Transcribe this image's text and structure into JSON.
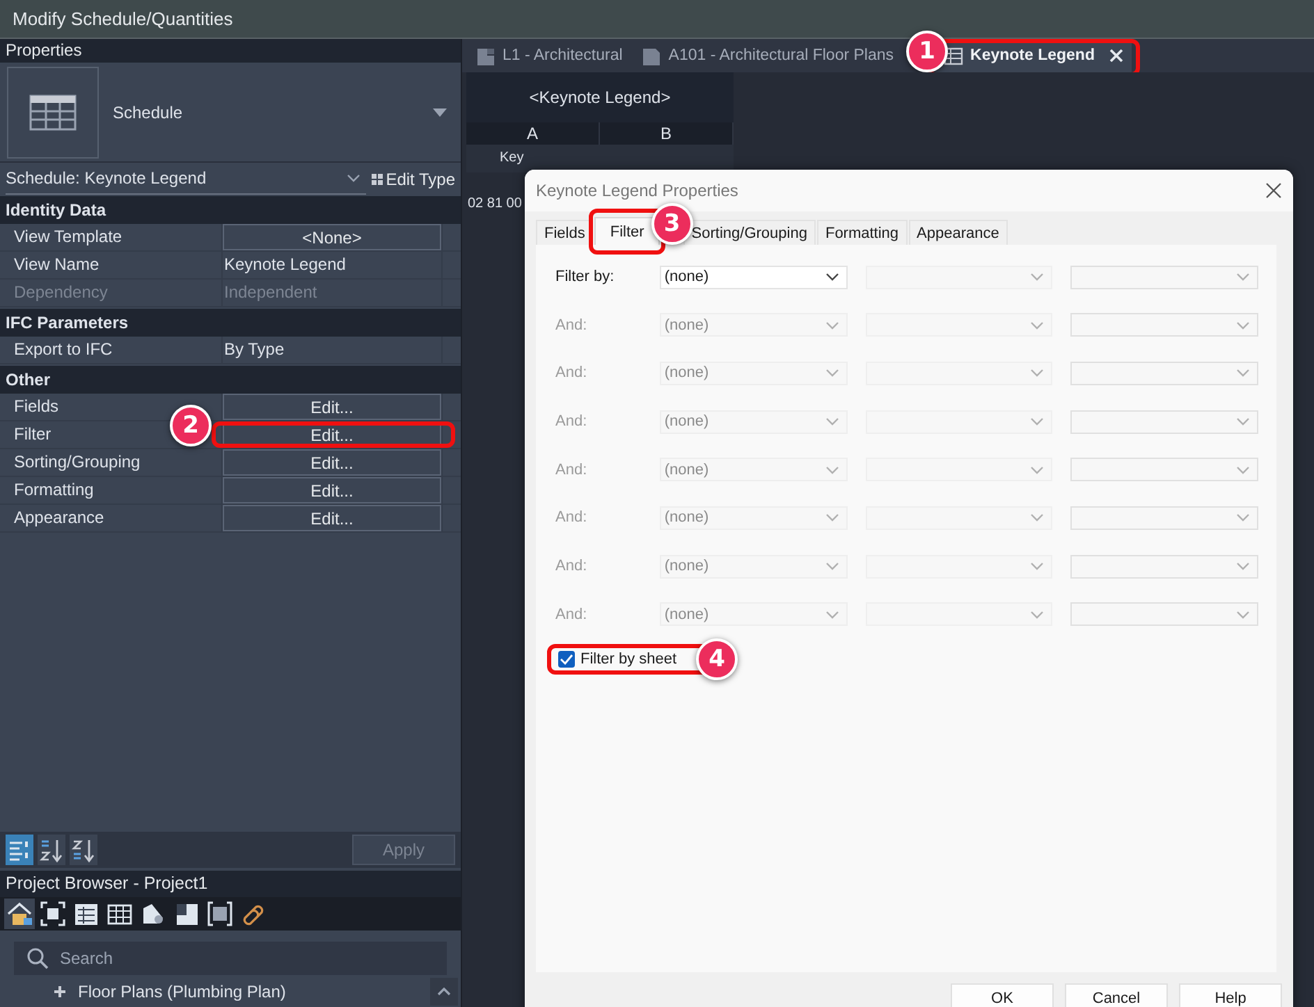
{
  "title_bar": {
    "title": "Modify Schedule/Quantities"
  },
  "properties": {
    "title": "Properties",
    "type_name": "Schedule",
    "instance": "Schedule: Keynote Legend",
    "edit_type": "Edit Type",
    "groups": [
      {
        "name": "Identity Data",
        "rows": [
          {
            "label": "View Template",
            "value": "<None>",
            "kind": "button",
            "disabled": false
          },
          {
            "label": "View Name",
            "value": "Keynote Legend",
            "kind": "text",
            "disabled": false
          },
          {
            "label": "Dependency",
            "value": "Independent",
            "kind": "text",
            "disabled": true
          }
        ]
      },
      {
        "name": "IFC Parameters",
        "rows": [
          {
            "label": "Export to IFC",
            "value": "By Type",
            "kind": "text",
            "disabled": false
          }
        ]
      },
      {
        "name": "Other",
        "rows": [
          {
            "label": "Fields",
            "value": "Edit...",
            "kind": "button",
            "disabled": false
          },
          {
            "label": "Filter",
            "value": "Edit...",
            "kind": "button",
            "disabled": false,
            "badge": "2"
          },
          {
            "label": "Sorting/Grouping",
            "value": "Edit...",
            "kind": "button",
            "disabled": false
          },
          {
            "label": "Formatting",
            "value": "Edit...",
            "kind": "button",
            "disabled": false
          },
          {
            "label": "Appearance",
            "value": "Edit...",
            "kind": "button",
            "disabled": false
          }
        ]
      }
    ],
    "sort_buttons": [
      {
        "selected": true
      },
      {
        "selected": false
      },
      {
        "selected": false
      }
    ],
    "apply": {
      "label": "Apply",
      "disabled": true
    }
  },
  "project_browser": {
    "title": "Project Browser - Project1",
    "search": {
      "placeholder": "Search"
    },
    "tree": [
      {
        "label": "Floor Plans (Plumbing Plan)",
        "expanded": false
      }
    ]
  },
  "view_tabs": [
    {
      "label": "L1 - Architectural",
      "selected": false
    },
    {
      "label": "A101 - Architectural Floor Plans",
      "selected": false
    },
    {
      "label": "Keynote Legend",
      "selected": true,
      "badge": "1"
    }
  ],
  "schedule": {
    "title": "<Keynote Legend>",
    "columns": [
      "A",
      "B"
    ],
    "header_cells": [
      "Key"
    ],
    "rows": [
      [
        "02 81 00"
      ]
    ]
  },
  "dialog": {
    "title": "Keynote Legend Properties",
    "tabs": [
      {
        "label": "Fields",
        "selected": false
      },
      {
        "label": "Filter",
        "selected": true,
        "badge": "3"
      },
      {
        "label": "Sorting/Grouping",
        "selected": false
      },
      {
        "label": "Formatting",
        "selected": false
      },
      {
        "label": "Appearance",
        "selected": false
      }
    ],
    "filters": [
      {
        "label": "Filter by:",
        "value": "(none)",
        "disabled": false
      },
      {
        "label": "And:",
        "value": "(none)",
        "disabled": true
      },
      {
        "label": "And:",
        "value": "(none)",
        "disabled": true
      },
      {
        "label": "And:",
        "value": "(none)",
        "disabled": true
      },
      {
        "label": "And:",
        "value": "(none)",
        "disabled": true
      },
      {
        "label": "And:",
        "value": "(none)",
        "disabled": true
      },
      {
        "label": "And:",
        "value": "(none)",
        "disabled": true
      },
      {
        "label": "And:",
        "value": "(none)",
        "disabled": true
      }
    ],
    "filter_by_sheet": {
      "label": "Filter by sheet",
      "checked": true,
      "badge": "4"
    },
    "buttons": [
      "OK",
      "Cancel",
      "Help"
    ]
  }
}
